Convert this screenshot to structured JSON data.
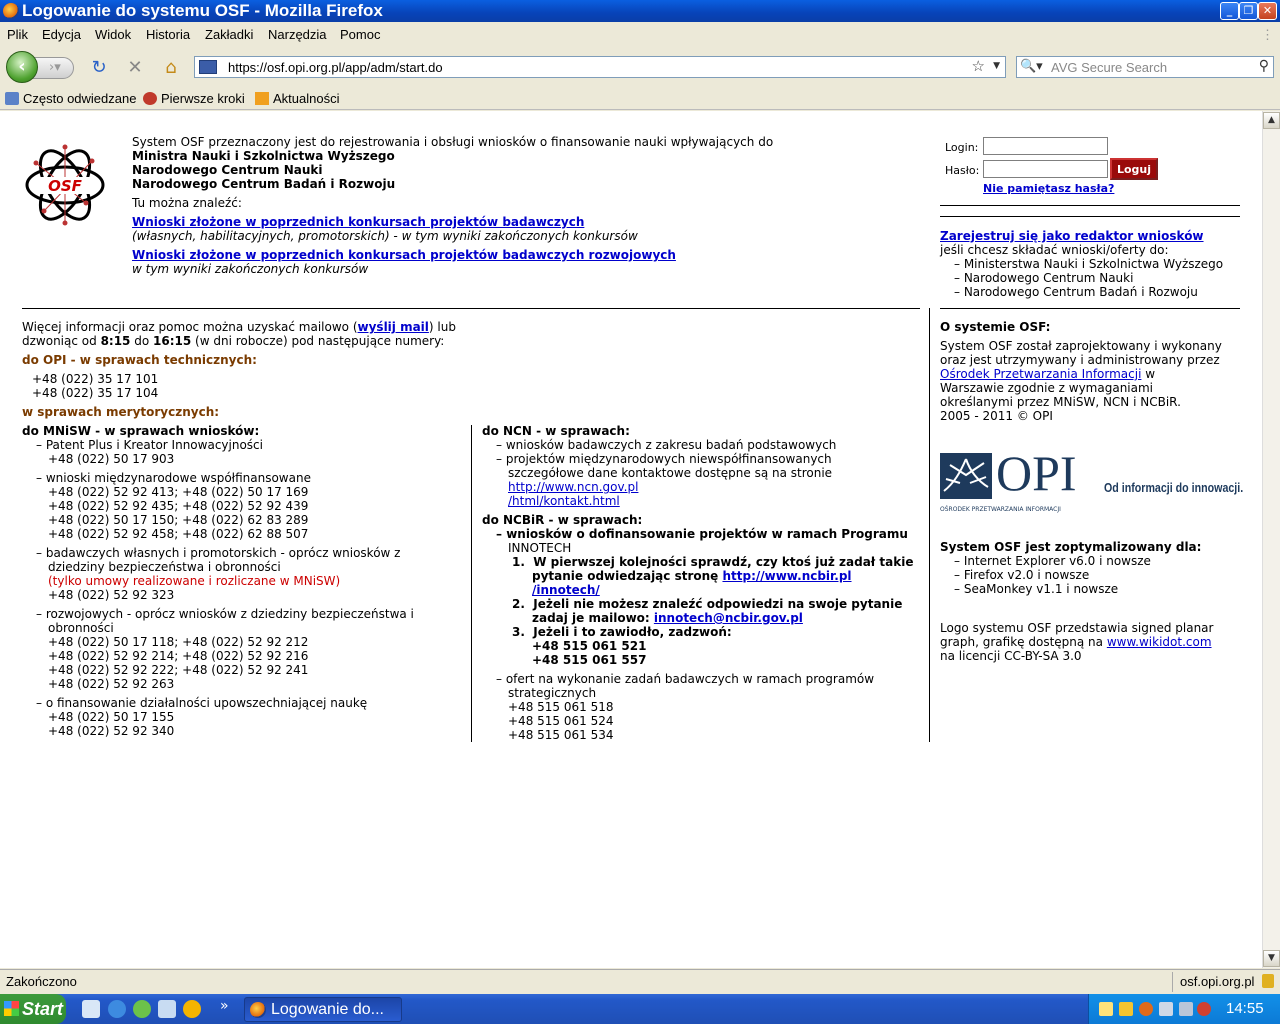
{
  "window": {
    "title": "Logowanie do systemu OSF - Mozilla Firefox"
  },
  "menu": [
    "Plik",
    "Edycja",
    "Widok",
    "Historia",
    "Zakładki",
    "Narzędzia",
    "Pomoc"
  ],
  "nav": {
    "url": "https://osf.opi.org.pl/app/adm/start.do",
    "search_placeholder": "AVG Secure Search"
  },
  "bookmarks": [
    "Często odwiedzane",
    "Pierwsze kroki",
    "Aktualności"
  ],
  "intro": {
    "line1": "System OSF przeznaczony jest do rejestrowania i obsługi wniosków o finansowanie nauki wpływających do",
    "inst1": "Ministra Nauki i Szkolnictwa Wyższego",
    "inst2": "Narodowego Centrum Nauki",
    "inst3": "Narodowego Centrum Badań i Rozwoju",
    "find": "Tu można znaleźć:",
    "link1": "Wnioski złożone w poprzednich konkursach projektów badawczych",
    "link1_desc": "(własnych, habilitacyjnych, promotorskich) - w tym wyniki zakończonych konkursów",
    "link2": "Wnioski złożone w poprzednich konkursach projektów badawczych rozwojowych",
    "link2_desc": "w tym wyniki zakończonych konkursów"
  },
  "login": {
    "login_label": "Login:",
    "password_label": "Hasło:",
    "button": "Loguj",
    "forgot": "Nie pamiętasz hasła?"
  },
  "register": {
    "link": "Zarejestruj się jako redaktor wniosków",
    "desc": "jeśli chcesz składać wnioski/oferty do:",
    "items": [
      "Ministerstwa Nauki i Szkolnictwa Wyższego",
      "Narodowego Centrum Nauki",
      "Narodowego Centrum Badań i Rozwoju"
    ]
  },
  "contact": {
    "l1a": "Więcej informacji oraz pomoc można uzyskać mailowo (",
    "mail": "wyślij mail",
    "l1b": ") lub",
    "l2a": "dzwoniąc od ",
    "t1": "8:15",
    "l2b": " do ",
    "t2": "16:15",
    "l2c": " (w dni robocze) pod następujące numery:",
    "opi_head": "do OPI - w sprawach technicznych:",
    "opi_phones": [
      "+48 (022) 35 17 101",
      "+48 (022) 35 17 104"
    ],
    "merit_head": "w sprawach merytorycznych:"
  },
  "mnisw": {
    "head": "do MNiSW - w sprawach wniosków:",
    "i1": "Patent Plus i Kreator Innowacyjności",
    "i1p": [
      "+48 (022) 50 17 903"
    ],
    "i2": "wnioski międzynarodowe współfinansowane",
    "i2p": [
      "+48 (022) 52 92 413; +48 (022) 50 17 169",
      "+48 (022) 52 92 435; +48 (022) 52 92 439",
      "+48 (022) 50 17 150; +48 (022) 62 83 289",
      "+48 (022) 52 92 458; +48 (022) 62 88 507"
    ],
    "i3a": "badawczych własnych i promotorskich - oprócz wniosków z",
    "i3b": "dziedziny bezpieczeństwa i obronności",
    "i3red": "(tylko umowy realizowane i rozliczane w MNiSW)",
    "i3p": [
      "+48 (022) 52 92 323"
    ],
    "i4a": "rozwojowych - oprócz wniosków z dziedziny bezpieczeństwa i",
    "i4b": "obronności",
    "i4p": [
      "+48 (022) 50 17 118; +48 (022) 52 92 212",
      "+48 (022) 52 92 214; +48 (022) 52 92 216",
      "+48 (022) 52 92 222; +48 (022) 52 92 241",
      "+48 (022) 52 92 263"
    ],
    "i5": "o finansowanie działalności upowszechniającej naukę",
    "i5p": [
      "+48 (022) 50 17 155",
      "+48 (022) 52 92 340"
    ]
  },
  "ncn": {
    "head": "do NCN - w sprawach:",
    "i1": "wniosków badawczych z zakresu badań podstawowych",
    "i2a": "projektów międzynarodowych niewspółfinansowanych",
    "i2b": "szczegółowe dane kontaktowe dostępne są na stronie",
    "link_a": "http://www.ncn.gov.pl",
    "link_b": "/html/kontakt.html"
  },
  "ncbir": {
    "head": "do NCBiR - w sprawach:",
    "i1a": "wniosków o dofinansowanie projektów w ramach Programu",
    "i1b": "INNOTECH",
    "s1a": "W pierwszej kolejności sprawdź, czy ktoś już zadał takie",
    "s1b": "pytanie odwiedzając stronę ",
    "s1link_a": "http://www.ncbir.pl",
    "s1link_b": "/innotech/",
    "s2a": "Jeżeli nie możesz znaleźć odpowiedzi na swoje pytanie",
    "s2b": "zadaj je mailowo: ",
    "s2mail": "innotech@ncbir.gov.pl",
    "s3": "Jeżeli i to zawiodło, zadzwoń:",
    "s3p": [
      "+48 515 061 521",
      "+48 515 061 557"
    ],
    "i2a": "ofert na wykonanie zadań badawczych w ramach programów",
    "i2b": "strategicznych",
    "i2p": [
      "+48 515 061 518",
      "+48 515 061 524",
      "+48 515 061 534"
    ]
  },
  "about": {
    "head": "O systemie OSF:",
    "l1": "System OSF został zaprojektowany i wykonany",
    "l2": "oraz jest utrzymywany i administrowany przez",
    "link": "Ośrodek Przetwarzania Informacji",
    "l3b": " w",
    "l4": "Warszawie zgodnie z wymaganiami",
    "l5": "określanymi przez MNiSW, NCN i NCBiR.",
    "l6": "2005 - 2011 © OPI",
    "opi_logo": "OPI",
    "opi_sub": "OŚRODEK PRZETWARZANIA INFORMACJI",
    "opi_slogan": "Od informacji do innowacji.",
    "opt_head": "System OSF jest zoptymalizowany dla:",
    "opt": [
      "Internet Explorer v6.0 i nowsze",
      "Firefox v2.0 i nowsze",
      "SeaMonkey v1.1 i nowsze"
    ],
    "logo1": "Logo systemu OSF przedstawia signed planar",
    "logo2a": "graph, grafikę dostępną na ",
    "logo2link": "www.wikidot.com",
    "logo3": "na licencji CC-BY-SA 3.0",
    "osf_logo": "OSF"
  },
  "status": {
    "left": "Zakończono",
    "right": "osf.opi.org.pl"
  },
  "taskbar": {
    "start": "Start",
    "item": "Logowanie do...",
    "clock": "14:55",
    "chevron": "»"
  }
}
